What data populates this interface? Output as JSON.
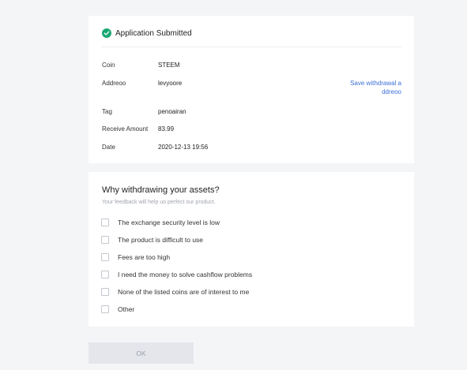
{
  "status": {
    "text": "Application Submitted",
    "icon": "check-circle-icon",
    "color": "#19a874"
  },
  "details": {
    "coin_label": "Coin",
    "coin_value": "STEEM",
    "address_label": "Addreoo",
    "address_value": "levyoore",
    "save_link": "Save withdrawal a ddreoo",
    "tag_label": "Tag",
    "tag_value": "penoairan",
    "receive_label": "Receive Amount",
    "receive_value": "83.99",
    "date_label": "Date",
    "date_value": "2020-12-13 19:56"
  },
  "feedback": {
    "title": "Why withdrawing your assets?",
    "subtitle": "Your feedback will help uo perfect our product.",
    "options": [
      "The exchange security level is low",
      "The product is difficult to use",
      "Fees are too high",
      "I need the money to solve cashflow problems",
      "None of the listed coins are of interest to me",
      "Other"
    ]
  },
  "ok_button": "OK",
  "colors": {
    "background": "#f4f5f7",
    "link": "#3a6fd8",
    "success": "#19a874"
  }
}
